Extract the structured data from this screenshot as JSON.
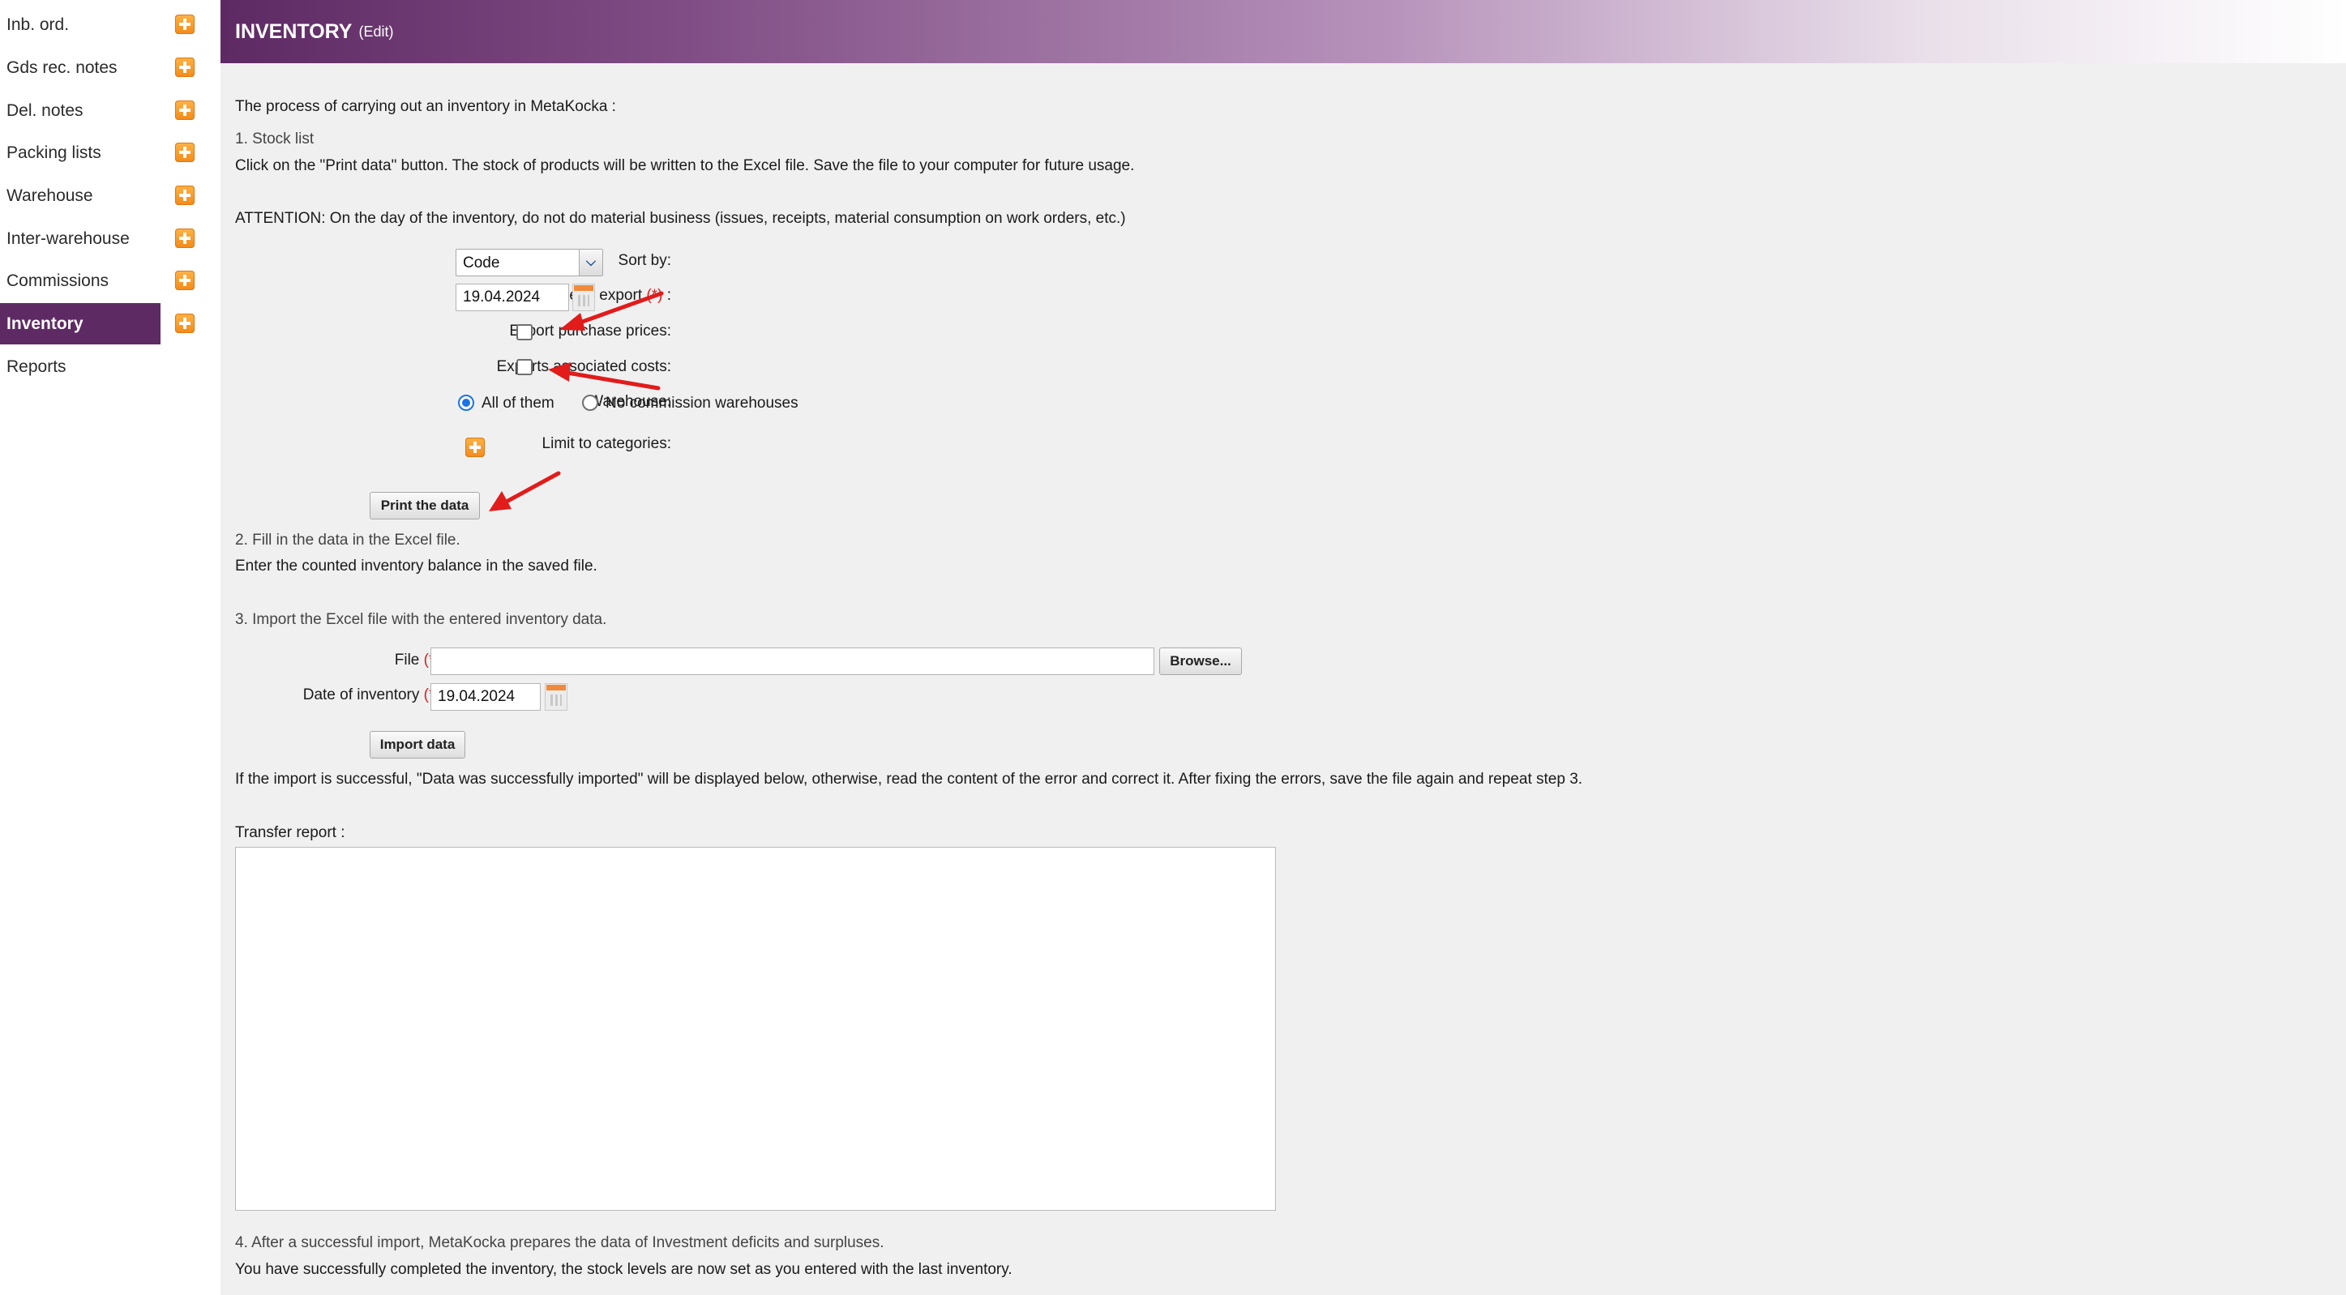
{
  "sidebar": {
    "items": [
      {
        "label": "Inb. ord.",
        "has_add": true,
        "active": false
      },
      {
        "label": "Gds rec. notes",
        "has_add": true,
        "active": false
      },
      {
        "label": "Del. notes",
        "has_add": true,
        "active": false
      },
      {
        "label": "Packing lists",
        "has_add": true,
        "active": false
      },
      {
        "label": "Warehouse",
        "has_add": true,
        "active": false
      },
      {
        "label": "Inter-warehouse",
        "has_add": true,
        "active": false
      },
      {
        "label": "Commissions",
        "has_add": true,
        "active": false
      },
      {
        "label": "Inventory",
        "has_add": true,
        "active": true
      },
      {
        "label": "Reports",
        "has_add": false,
        "active": false
      }
    ]
  },
  "header": {
    "title": "INVENTORY",
    "edit_label": "(Edit)"
  },
  "intro": "The process of carrying out an inventory in MetaKocka :",
  "step1": {
    "title": "1. Stock list",
    "text": "Click on the \"Print data\" button. The stock of products will be written to the Excel file. Save the file to your computer for future usage.",
    "attention": "ATTENTION: On the day of the inventory, do not do material business (issues, receipts, material consumption on work orders, etc.)"
  },
  "form1": {
    "sort_by_label": "Sort by:",
    "sort_by_value": "Code",
    "date_export_label": "Date of export",
    "date_export_colon": " :",
    "date_export_value": "19.04.2024",
    "export_purchase_label": "Export purchase prices:",
    "export_costs_label": "Exports associated costs:",
    "warehouse_label": "Warehouse:",
    "warehouse_options": [
      "All of them",
      "No commission warehouses"
    ],
    "limit_categories_label": "Limit to categories:",
    "print_button": "Print the data"
  },
  "required_marker": "(*)",
  "step2": {
    "title": "2. Fill in the data in the Excel file.",
    "text": "Enter the counted inventory balance in the saved file."
  },
  "step3": {
    "title": "3. Import the Excel file with the entered inventory data.",
    "file_label": "File",
    "file_value": "",
    "browse_button": "Browse...",
    "date_inventory_label": "Date of inventory",
    "date_inventory_value": "19.04.2024",
    "colon": ":",
    "import_button": "Import data",
    "note": "If the import is successful, \"Data was successfully imported\" will be displayed below, otherwise, read the content of the error and correct it. After fixing the errors, save the file again and repeat step 3."
  },
  "transfer_report_label": "Transfer report :",
  "transfer_report_value": "",
  "step4": {
    "title": "4. After a successful import, MetaKocka prepares the data of Investment deficits and surpluses.",
    "text": "You have successfully completed the inventory, the stock levels are now set as you entered with the last inventory."
  },
  "colors": {
    "accent": "#5e2a63",
    "annotation_arrow": "#e21b1b",
    "required": "#d42020"
  }
}
